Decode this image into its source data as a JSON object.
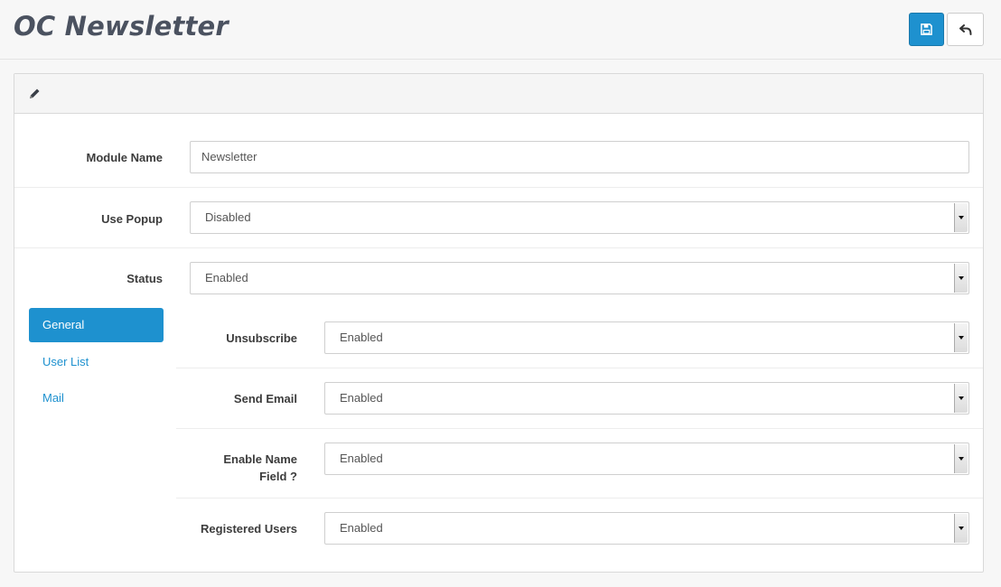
{
  "header": {
    "title": "OC Newsletter",
    "save_icon": "floppy-disk-icon",
    "back_icon": "reply-arrow-icon"
  },
  "panel": {
    "heading_icon": "pencil-icon"
  },
  "form": {
    "module_name": {
      "label": "Module Name",
      "value": "Newsletter"
    },
    "use_popup": {
      "label": "Use Popup",
      "value": "Disabled"
    },
    "status": {
      "label": "Status",
      "value": "Enabled"
    }
  },
  "tabs": [
    {
      "label": "General",
      "active": true
    },
    {
      "label": "User List",
      "active": false
    },
    {
      "label": "Mail",
      "active": false
    }
  ],
  "general": {
    "unsubscribe": {
      "label": "Unsubscribe",
      "value": "Enabled"
    },
    "send_email": {
      "label": "Send Email",
      "value": "Enabled"
    },
    "enable_name_field": {
      "label_line1": "Enable Name",
      "label_line2": "Field ?",
      "value": "Enabled"
    },
    "registered_users": {
      "label": "Registered Users",
      "value": "Enabled"
    }
  },
  "colors": {
    "accent": "#1e91cf",
    "title": "#4b5260",
    "page_bg": "#f7f7f7"
  }
}
